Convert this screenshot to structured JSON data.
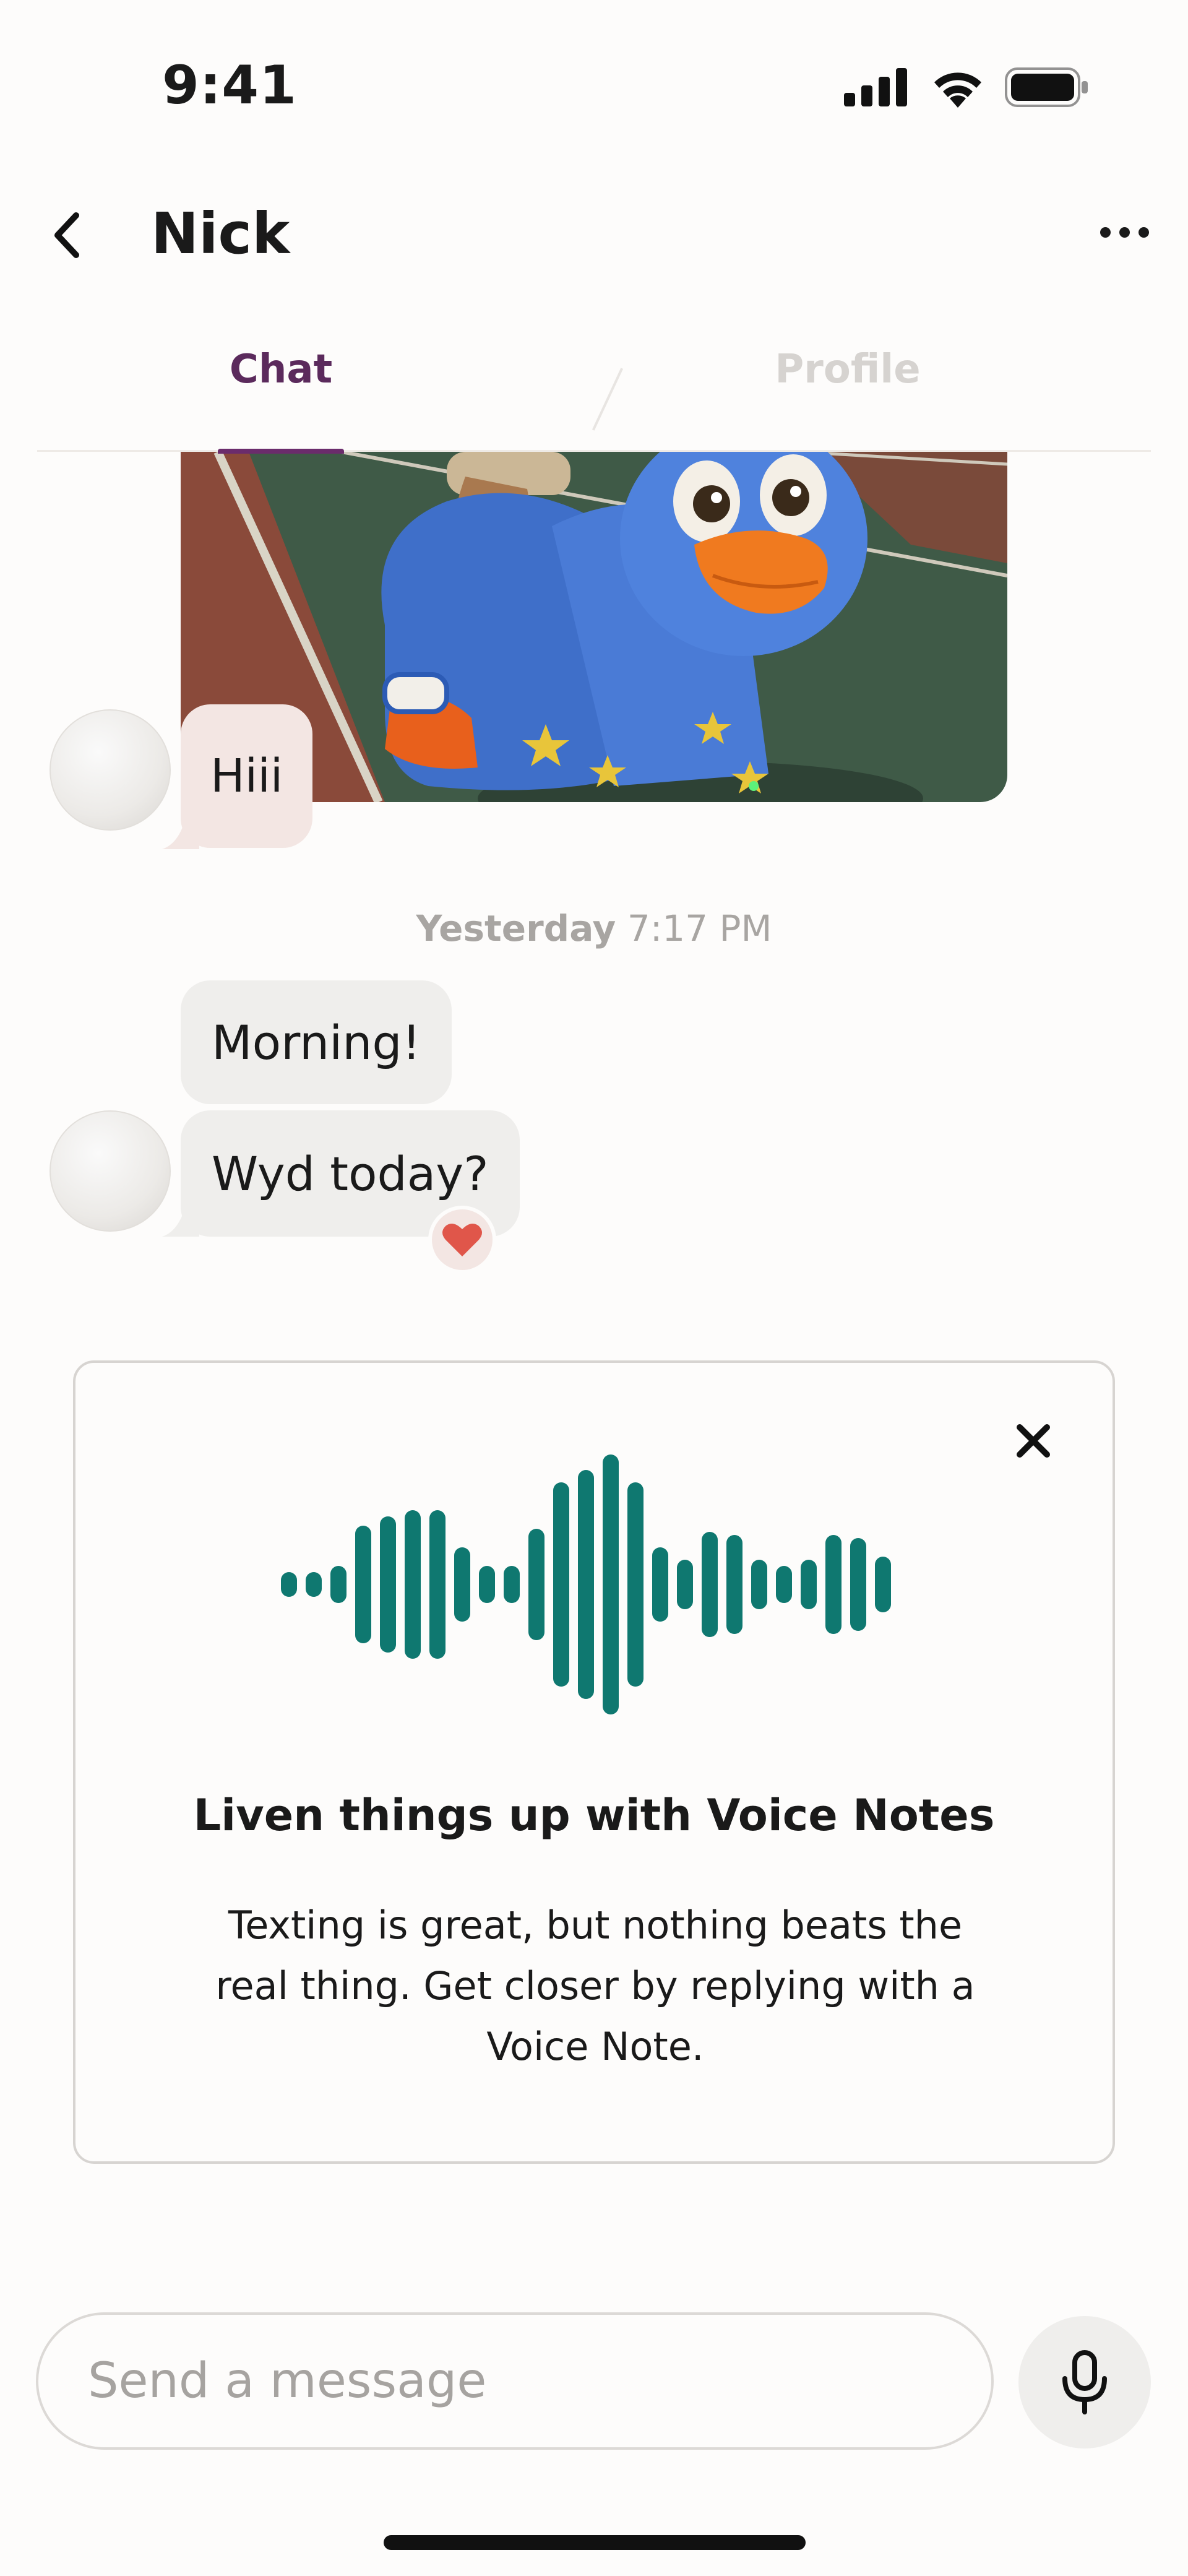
{
  "status_bar": {
    "time": "9:41",
    "icons": [
      "signal-icon",
      "wifi-icon",
      "battery-icon"
    ]
  },
  "header": {
    "title": "Nick",
    "back_icon": "chevron-left-icon",
    "more_icon": "more-horizontal-icon"
  },
  "tabs": [
    {
      "label": "Chat",
      "active": true
    },
    {
      "label": "Profile",
      "active": false
    }
  ],
  "messages": {
    "first": {
      "text": "Hiii"
    },
    "timestamp": {
      "day": "Yesterday",
      "time": "7:17 PM"
    },
    "second": {
      "text": "Morning!"
    },
    "third": {
      "text": "Wyd today?",
      "reaction": "heart-icon"
    }
  },
  "voice_card": {
    "title": "Liven things up with Voice Notes",
    "body": "Texting is great, but nothing beats the real thing. Get closer by replying with a Voice Note.",
    "close_icon": "close-icon",
    "waveform_icon": "waveform-icon"
  },
  "composer": {
    "placeholder": "Send a message",
    "mic_icon": "microphone-icon"
  },
  "colors": {
    "accent": "#6b2c6c",
    "waveform": "#0f7870",
    "heart": "#e0564a",
    "pink_bubble": "#f3e6e3",
    "grey_bubble": "#efeeec"
  }
}
